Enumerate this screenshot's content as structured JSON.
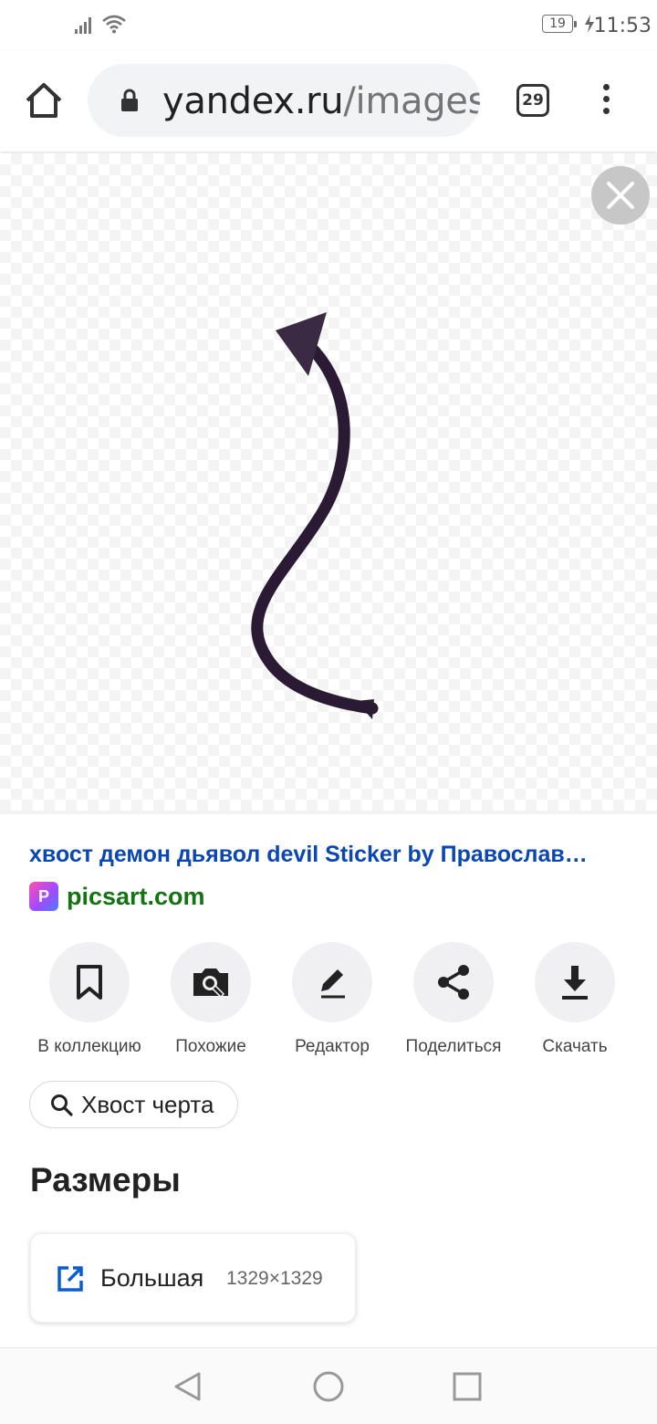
{
  "status_bar": {
    "battery": "19",
    "time": "11:53"
  },
  "browser": {
    "url_host": "yandex.ru",
    "url_path": "/images",
    "tab_count": "29"
  },
  "result": {
    "title": "хвост демон дьявол devil Sticker by Православ…",
    "source": "picsart.com",
    "favicon_letter": "P"
  },
  "actions": [
    {
      "label": "В коллекцию",
      "icon": "bookmark-icon"
    },
    {
      "label": "Похожие",
      "icon": "camera-search-icon"
    },
    {
      "label": "Редактор",
      "icon": "pencil-icon"
    },
    {
      "label": "Поделиться",
      "icon": "share-icon"
    },
    {
      "label": "Скачать",
      "icon": "download-icon"
    }
  ],
  "search_chip": {
    "label": "Хвост черта"
  },
  "sizes": {
    "heading": "Размеры",
    "items": [
      {
        "name": "Большая",
        "dims": "1329×1329"
      }
    ]
  },
  "colors": {
    "title_link": "#0a46b4",
    "source_link": "#157313",
    "tail": "#2a1a33"
  }
}
